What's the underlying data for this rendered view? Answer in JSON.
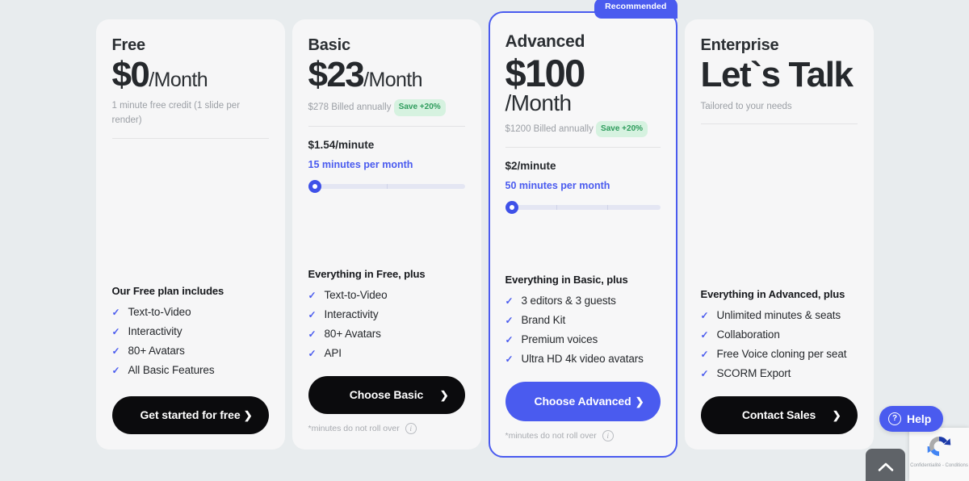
{
  "page": {
    "background_color": "#e8ecee",
    "accent_color": "#4a5bef",
    "card_background": "#f6f6f7"
  },
  "plans": [
    {
      "name": "Free",
      "price_main": "$0",
      "price_period": "/Month",
      "billing_note": "1 minute free credit (1 slide per render)",
      "save_badge": "",
      "rate": "",
      "minutes": "",
      "features_title": "Our Free plan includes",
      "features": [
        "Text-to-Video",
        "Interactivity",
        "80+ Avatars",
        "All Basic Features"
      ],
      "cta_label": "Get started for free",
      "footnote": ""
    },
    {
      "name": "Basic",
      "price_main": "$23",
      "price_period": "/Month",
      "billing_note": "$278 Billed annually",
      "save_badge": "Save +20%",
      "rate": "$1.54/minute",
      "minutes": "15 minutes per month",
      "features_title": "Everything in Free, plus",
      "features": [
        "Text-to-Video",
        "Interactivity",
        "80+ Avatars",
        "API"
      ],
      "cta_label": "Choose Basic",
      "footnote": "*minutes do not roll over"
    },
    {
      "name": "Advanced",
      "price_main": "$100",
      "price_period": "/Month",
      "billing_note": "$1200 Billed annually",
      "save_badge": "Save +20%",
      "rate": "$2/minute",
      "minutes": "50 minutes per month",
      "features_title": "Everything in Basic, plus",
      "features": [
        "3 editors & 3 guests",
        "Brand Kit",
        "Premium voices",
        "Ultra HD 4k video avatars"
      ],
      "cta_label": "Choose Advanced",
      "footnote": "*minutes do not roll over",
      "recommended_badge": "Recommended"
    },
    {
      "name": "Enterprise",
      "price_main": "Let`s Talk",
      "price_period": "",
      "billing_note": "Tailored to your needs",
      "save_badge": "",
      "rate": "",
      "minutes": "",
      "features_title": "Everything in Advanced, plus",
      "features": [
        "Unlimited minutes & seats",
        "Collaboration",
        "Free Voice cloning per seat",
        "SCORM Export"
      ],
      "cta_label": "Contact Sales",
      "footnote": ""
    }
  ],
  "widgets": {
    "help_label": "Help",
    "scroll_top_label": "",
    "recaptcha_text": "Confidentialité - Conditions"
  },
  "glyphs": {
    "check": "✓",
    "chevron_right": "❯",
    "chevron_up": "︿",
    "info": "i",
    "question": "?"
  }
}
